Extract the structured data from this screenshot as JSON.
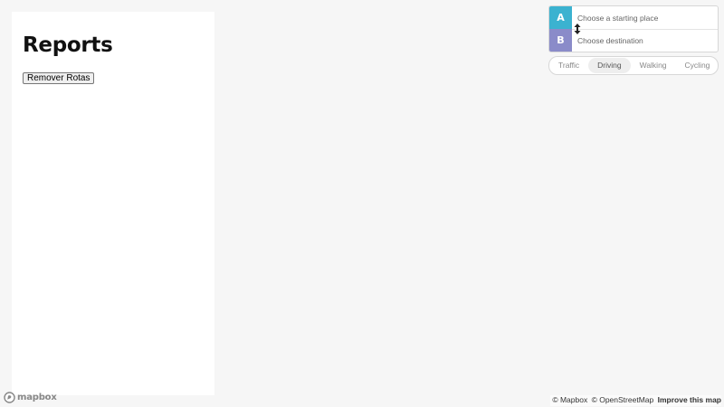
{
  "panel": {
    "title": "Reports",
    "remove_routes_label": "Remover Rotas"
  },
  "directions": {
    "origin": {
      "marker": "A",
      "placeholder": "Choose a starting place",
      "value": ""
    },
    "destination": {
      "marker": "B",
      "placeholder": "Choose destination",
      "value": ""
    },
    "reverse_icon": "swap-vertical-icon",
    "profiles": [
      {
        "label": "Traffic",
        "active": false
      },
      {
        "label": "Driving",
        "active": true
      },
      {
        "label": "Walking",
        "active": false
      },
      {
        "label": "Cycling",
        "active": false
      }
    ],
    "colors": {
      "marker_a": "#3bb2d0",
      "marker_b": "#8a8bc9"
    }
  },
  "footer": {
    "logo_text": "mapbox",
    "attribution": {
      "mapbox": "© Mapbox",
      "osm": "© OpenStreetMap",
      "improve": "Improve this map"
    }
  }
}
